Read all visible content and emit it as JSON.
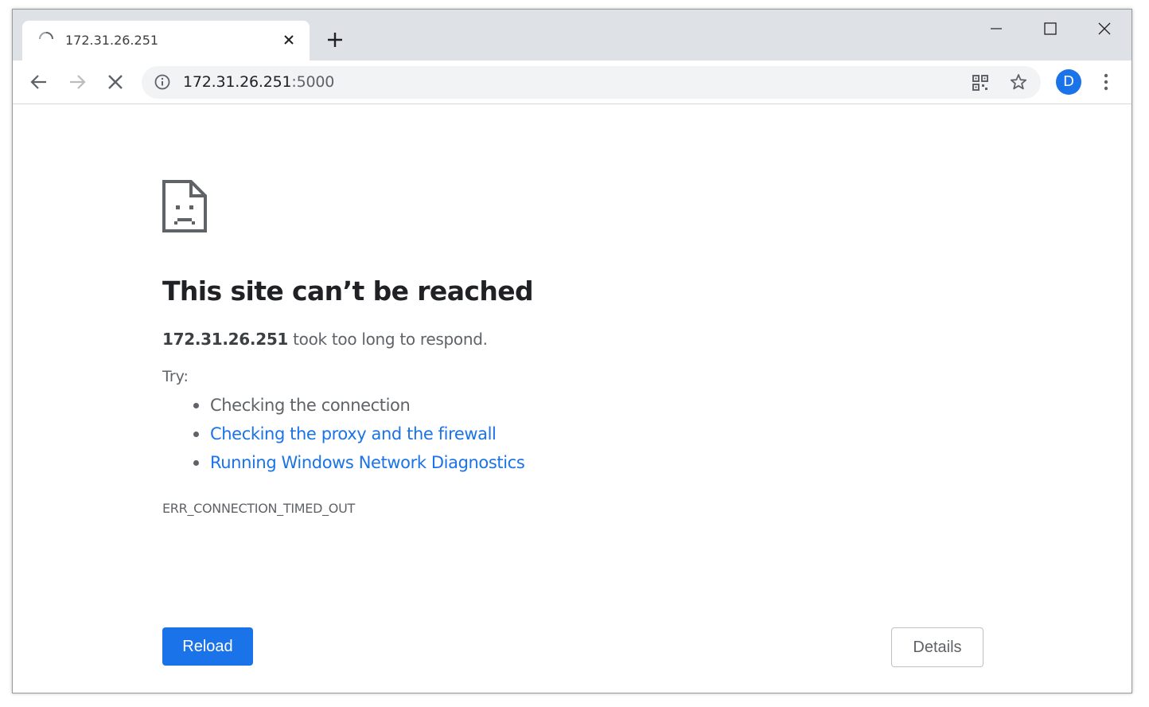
{
  "tab": {
    "title": "172.31.26.251"
  },
  "omnibox": {
    "host": "172.31.26.251",
    "port": ":5000"
  },
  "profile": {
    "initial": "D"
  },
  "error": {
    "heading": "This site can’t be reached",
    "host": "172.31.26.251",
    "message": " took too long to respond.",
    "try_label": "Try:",
    "suggestions": [
      {
        "text": "Checking the connection",
        "link": false
      },
      {
        "text": "Checking the proxy and the firewall",
        "link": true
      },
      {
        "text": "Running Windows Network Diagnostics",
        "link": true
      }
    ],
    "code": "ERR_CONNECTION_TIMED_OUT"
  },
  "buttons": {
    "reload": "Reload",
    "details": "Details"
  },
  "icons": {
    "tab": "loading-spinner-icon",
    "info": "info-icon",
    "qr": "qr-code-icon",
    "bookmark": "star-icon",
    "menu": "more-vert-icon"
  },
  "colors": {
    "accent": "#1a73e8",
    "text": "#5f6368",
    "heading": "#202124"
  }
}
